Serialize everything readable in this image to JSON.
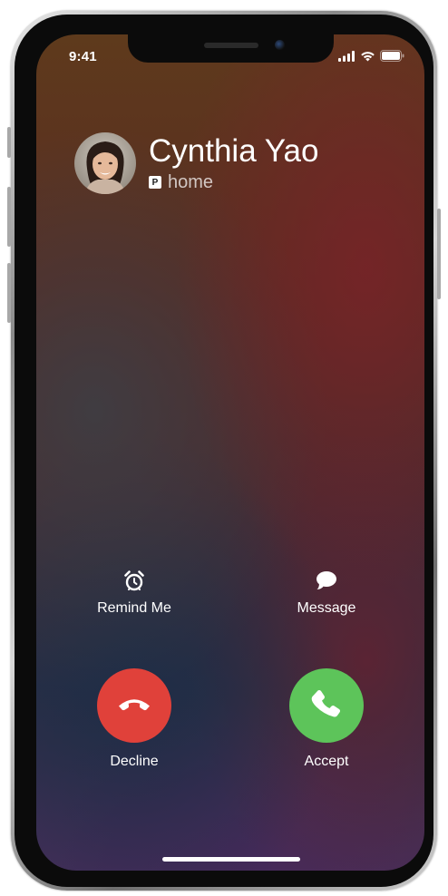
{
  "status_bar": {
    "time": "9:41",
    "icons": [
      "cellular-signal-icon",
      "wifi-icon",
      "battery-icon"
    ]
  },
  "caller": {
    "name": "Cynthia Yao",
    "label_badge": "P",
    "label": "home"
  },
  "actions": {
    "remind": {
      "label": "Remind Me",
      "icon": "alarm-clock-icon"
    },
    "message": {
      "label": "Message",
      "icon": "speech-bubble-icon"
    }
  },
  "call_buttons": {
    "decline": {
      "label": "Decline",
      "icon": "phone-hangup-icon",
      "color": "#e0413a"
    },
    "accept": {
      "label": "Accept",
      "icon": "phone-icon",
      "color": "#5dc45a"
    }
  }
}
